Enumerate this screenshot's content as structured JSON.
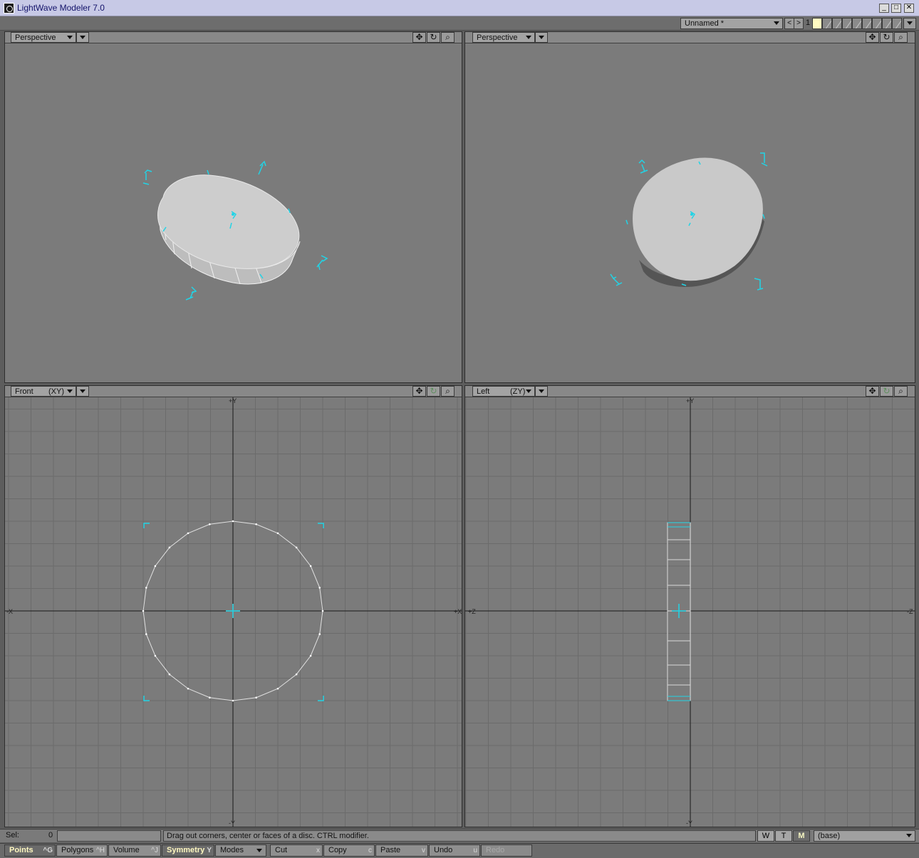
{
  "window": {
    "title": "LightWave Modeler 7.0",
    "minimize": "_",
    "maximize": "□",
    "close": "✕"
  },
  "topbar": {
    "object_name": "Unnamed *",
    "prev": "<",
    "next": ">",
    "layer_number": "1"
  },
  "viewports": [
    {
      "view": "Perspective",
      "axes": ""
    },
    {
      "view": "Perspective",
      "axes": ""
    },
    {
      "view": "Front",
      "axes": "(XY)"
    },
    {
      "view": "Left",
      "axes": "(ZY)"
    }
  ],
  "viewport_icons": {
    "move": "✥",
    "rotate": "↻",
    "zoom": "⌕"
  },
  "axis_labels": {
    "front_top": "+Y",
    "front_bottom": "-Y",
    "front_left": "-X",
    "front_right": "+X",
    "left_top": "+Y",
    "left_bottom": "-Y",
    "left_left": "+Z",
    "left_right": "-Z"
  },
  "status": {
    "sel_label": "Sel:",
    "sel_value": "0",
    "message": "Drag out corners, center or faces of a disc. CTRL modifier.",
    "w": "W",
    "t": "T",
    "m": "M",
    "layer": "(base)"
  },
  "toolbar": [
    {
      "label": "Points",
      "shortcut": "^G"
    },
    {
      "label": "Polygons",
      "shortcut": "^H"
    },
    {
      "label": "Volume",
      "shortcut": "^J"
    },
    {
      "label": "Symmetry",
      "shortcut": "Y"
    },
    {
      "label": "Modes",
      "shortcut": ""
    },
    {
      "label": "Cut",
      "shortcut": "x"
    },
    {
      "label": "Copy",
      "shortcut": "c"
    },
    {
      "label": "Paste",
      "shortcut": "v"
    },
    {
      "label": "Undo",
      "shortcut": "u"
    },
    {
      "label": "Redo",
      "shortcut": ""
    }
  ],
  "colors": {
    "accent_cyan": "#21d4e6",
    "grid": "#6b6b6b",
    "axis": "#1a1a1a",
    "wire": "#e0e0e0",
    "disc_face": "#cdcdcd"
  }
}
